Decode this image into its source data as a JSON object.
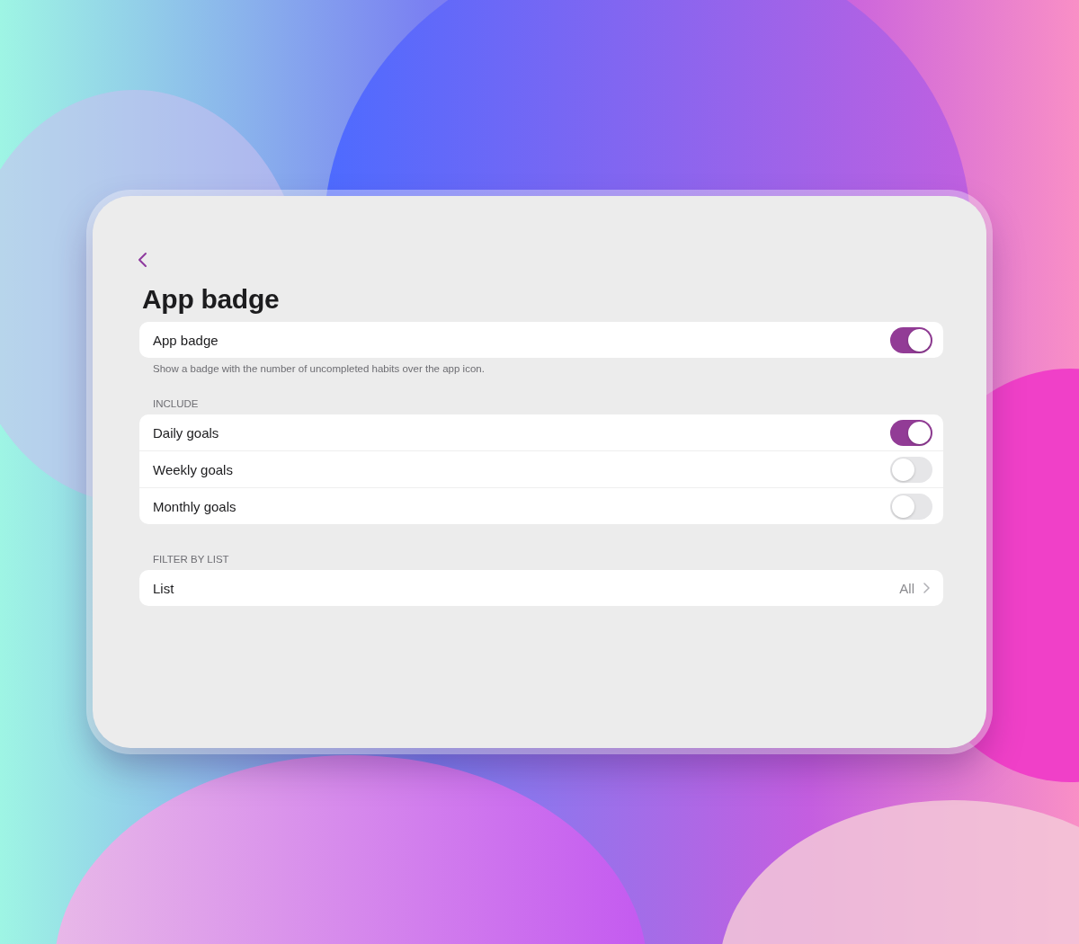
{
  "title": "App badge",
  "badge_row": {
    "label": "App badge",
    "on": true
  },
  "badge_note": "Show a badge with the number of uncompleted habits over the app icon.",
  "include": {
    "header": "INCLUDE",
    "items": [
      {
        "label": "Daily goals",
        "on": true
      },
      {
        "label": "Weekly goals",
        "on": false
      },
      {
        "label": "Monthly goals",
        "on": false
      }
    ]
  },
  "filter": {
    "header": "FILTER BY LIST",
    "label": "List",
    "value": "All"
  }
}
